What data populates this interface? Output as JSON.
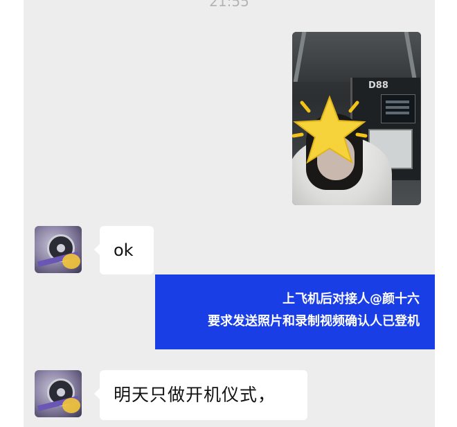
{
  "chat": {
    "timestamp": "21:55",
    "messages": [
      {
        "side": "right",
        "kind": "image",
        "image_label": "D88"
      },
      {
        "side": "left",
        "kind": "text",
        "text": "ok"
      },
      {
        "side": "left",
        "kind": "text",
        "text": "明天只做开机仪式，"
      }
    ]
  },
  "annotation": {
    "line1": "上飞机后对接人@颜十六",
    "line2": "要求发送照片和录制视频确认人已登机",
    "color": "#1a3ee6"
  },
  "icons": {
    "avatar": "film-reel-avatar",
    "overlay": "star-icon"
  }
}
